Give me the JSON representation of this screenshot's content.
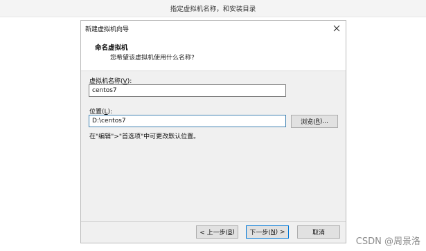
{
  "caption": "指定虚拟机名称，和安装目录",
  "dialog": {
    "title": "新建虚拟机向导",
    "close_icon": "close-icon",
    "header": {
      "title": "命名虚拟机",
      "subtitle": "您希望该虚拟机使用什么名称?"
    },
    "vm_name": {
      "label": "虚拟机名称",
      "accel": "V",
      "value": "centos7"
    },
    "location": {
      "label": "位置",
      "accel": "L",
      "value": "D:\\centos7",
      "browse_label": "浏览(",
      "browse_accel": "R",
      "browse_suffix": ")..."
    },
    "hint": "在\"编辑\">\"首选项\"中可更改默认位置。",
    "footer": {
      "prev": "< 上一步(",
      "prev_accel": "B",
      "prev_suffix": ")",
      "next": "下一步(",
      "next_accel": "N",
      "next_suffix": ") >",
      "cancel": "取消"
    }
  },
  "watermark": "CSDN @周景洛"
}
